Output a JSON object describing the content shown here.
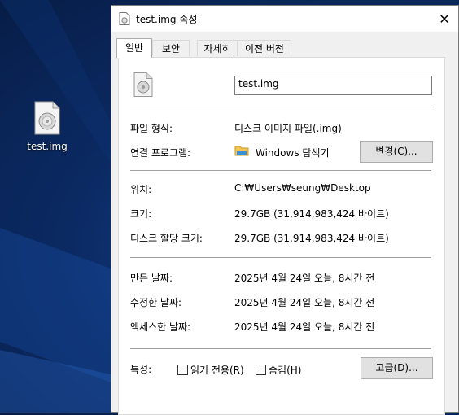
{
  "desktop": {
    "icon_label": "test.img",
    "icon": "disc-image-file-icon"
  },
  "dialog": {
    "title": "test.img 속성",
    "close_glyph": "✕",
    "tabs": [
      "일반",
      "보안",
      "자세히",
      "이전 버전"
    ],
    "active_tab": "일반",
    "file_name": "test.img",
    "type_label": "파일 형식:",
    "type_value": "디스크 이미지 파일(.img)",
    "opens_with_label": "연결 프로그램:",
    "opens_with_value": "Windows 탐색기",
    "change_button": "변경(C)...",
    "location_label": "위치:",
    "location_value": "C:₩Users₩seung₩Desktop",
    "size_label": "크기:",
    "size_value": "29.7GB (31,914,983,424 바이트)",
    "size_on_disk_label": "디스크 할당 크기:",
    "size_on_disk_value": "29.7GB (31,914,983,424 바이트)",
    "created_label": "만든 날짜:",
    "created_value": "2025년 4월 24일 오늘, 8시간 전",
    "modified_label": "수정한 날짜:",
    "modified_value": "2025년 4월 24일 오늘, 8시간 전",
    "accessed_label": "액세스한 날짜:",
    "accessed_value": "2025년 4월 24일 오늘, 8시간 전",
    "attributes_label": "특성:",
    "readonly_label": "읽기 전용(R)",
    "hidden_label": "숨김(H)",
    "advanced_button": "고급(D)...",
    "readonly_checked": false,
    "hidden_checked": false
  }
}
